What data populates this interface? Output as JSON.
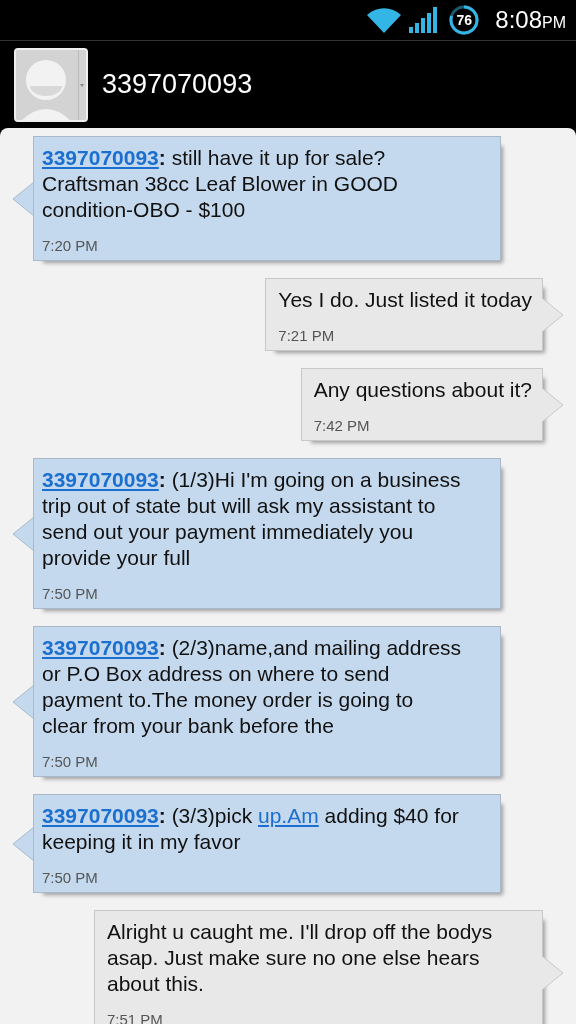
{
  "status_bar": {
    "battery": "76",
    "time": "8:08",
    "time_suffix": "PM"
  },
  "header": {
    "contact": "3397070093"
  },
  "messages": [
    {
      "kind": "incoming",
      "sender": "3397070093",
      "parts": [
        {
          "text": "**:** still have it up for sale? Craftsman 38cc Leaf Blower in GOOD condition-OBO - $100",
          "link": false
        }
      ],
      "time": "7:20 PM"
    },
    {
      "kind": "outgoing",
      "parts": [
        {
          "text": "Yes I do. Just listed it today",
          "link": false
        }
      ],
      "time": "7:21 PM"
    },
    {
      "kind": "outgoing",
      "parts": [
        {
          "text": "Any questions about it?",
          "link": false
        }
      ],
      "time": "7:42 PM"
    },
    {
      "kind": "incoming",
      "sender": "3397070093",
      "parts": [
        {
          "text": "**:** (1/3)Hi I'm going on a business trip out of state but will ask my assistant to send out your payment immediately you provide your full",
          "link": false
        }
      ],
      "time": "7:50 PM"
    },
    {
      "kind": "incoming",
      "sender": "3397070093",
      "parts": [
        {
          "text": "**:** (2/3)name,and mailing address or P.O Box address on where to send payment to.The money order is going to clear from your bank before the",
          "link": false
        }
      ],
      "time": "7:50 PM"
    },
    {
      "kind": "incoming",
      "sender": "3397070093",
      "parts": [
        {
          "text": "**:** (3/3)pick ",
          "link": false
        },
        {
          "text": "up.Am",
          "link": true
        },
        {
          "text": " adding $40 for keeping it in my favor",
          "link": false
        }
      ],
      "time": "7:50 PM"
    },
    {
      "kind": "outgoing",
      "parts": [
        {
          "text": "Alright u caught me. I'll drop off the bodys asap. Just make sure no one else hears about this.",
          "link": false
        }
      ],
      "time": "7:51 PM"
    }
  ]
}
